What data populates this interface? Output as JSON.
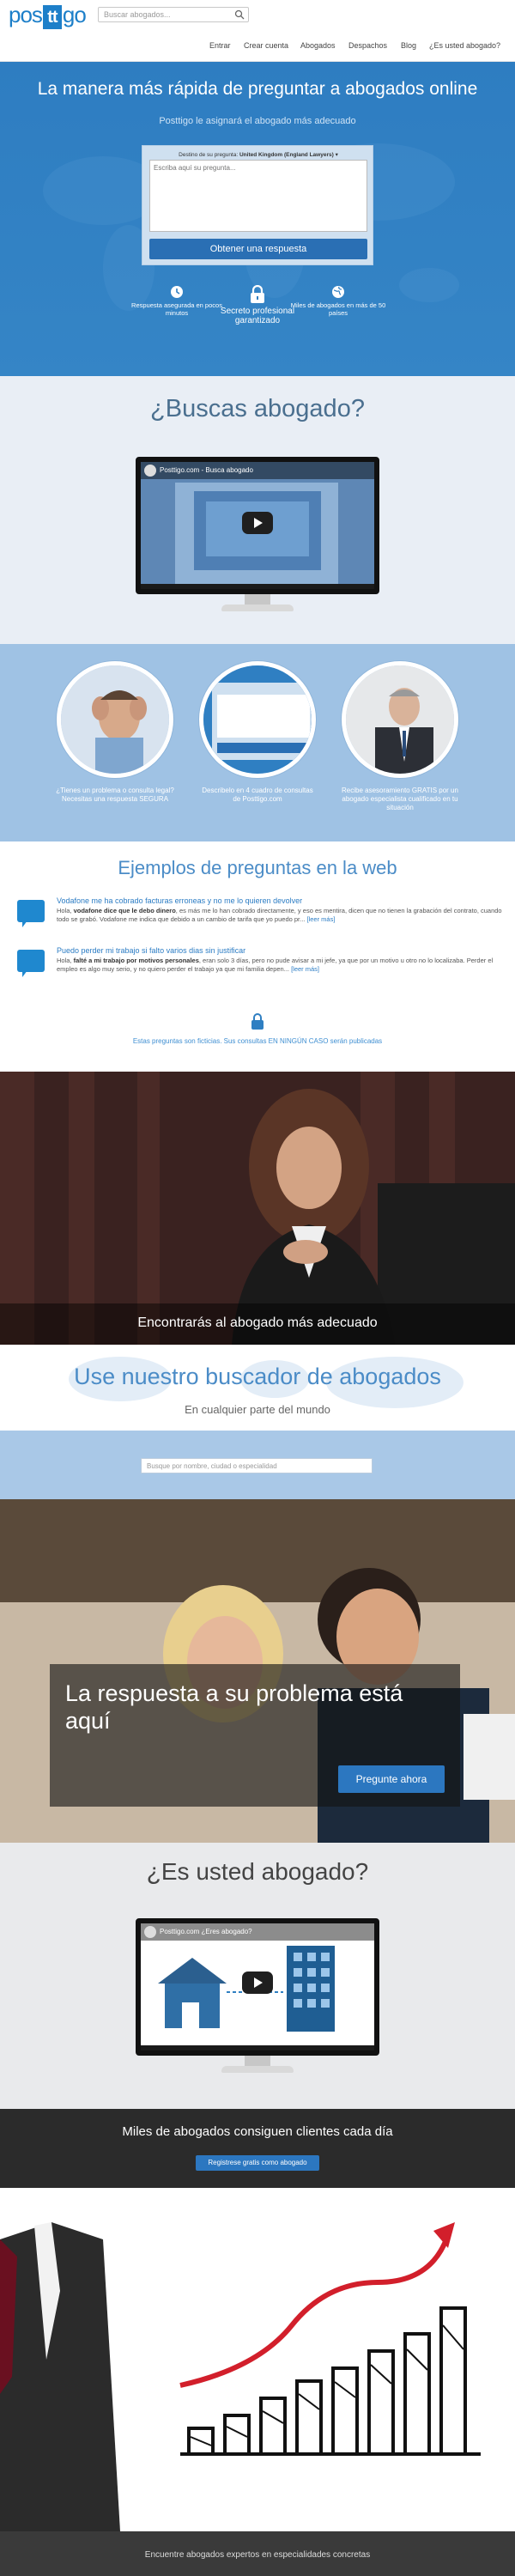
{
  "header": {
    "logo": "postt go",
    "search_placeholder": "Buscar abogados...",
    "nav": [
      "Entrar",
      "Crear cuenta",
      "Abogados",
      "Despachos",
      "Blog",
      "¿Es usted abogado?"
    ]
  },
  "hero": {
    "title": "La manera más rápida de preguntar a abogados online",
    "subtitle": "Posttigo le asignará el abogado más adecuado",
    "destination_label": "Destino de su pregunta:",
    "destination_value": "United Kingdom (England Lawyers)",
    "question_placeholder": "Escriba aquí su pregunta...",
    "submit_label": "Obtener una respuesta",
    "features": [
      {
        "icon": "clock-icon",
        "text": "Respuesta asegurada en pocos minutos"
      },
      {
        "icon": "lock-icon",
        "text": "Secreto profesional garantizado"
      },
      {
        "icon": "globe-icon",
        "text": "Miles de abogados en más de 50 países"
      }
    ]
  },
  "search_section": {
    "title": "¿Buscas abogado?",
    "video_title": "Posttigo.com - Busca abogado"
  },
  "steps": [
    {
      "text": "¿Tienes un problema o consulta legal? Necesitas una respuesta SEGURA"
    },
    {
      "text": "Describelo en 4 cuadro de consultas de Posttigo.com"
    },
    {
      "text": "Recibe asesoramiento GRATIS por un abogado especialista cualificado en tu situación"
    }
  ],
  "examples": {
    "title": "Ejemplos de preguntas en la web",
    "items": [
      {
        "title": "Vodafone me ha cobrado facturas erroneas y no me lo quieren devolver",
        "pre": "Hola, ",
        "bold": "vodafone dice que le debo dinero",
        "post": ", es más me lo han cobrado directamente, y eso es mentira, dicen que no tienen la grabación del contrato, cuando todo se grabó. Vodafone me indica que debido a un cambio de tarifa que yo puedo pr...",
        "more": "[leer más]"
      },
      {
        "title": "Puedo perder mi trabajo si falto varios dias sin justificar",
        "pre": "Hola, ",
        "bold": "falté a mi trabajo por motivos personales",
        "post": ", eran solo 3 días, pero no pude avisar a mi jefe, ya que por un motivo u otro no lo localizaba. Perder el empleo es algo muy serio, y no quiero perder el trabajo ya que mi familia depen...",
        "more": "[leer más]"
      }
    ],
    "privacy_note": "Estas preguntas son ficticias. Sus consultas EN NINGÚN CASO serán publicadas"
  },
  "photo_caption": "Encontrarás al abogado más adecuado",
  "finder": {
    "title": "Use nuestro buscador de abogados",
    "subtitle": "En cualquier parte del mundo",
    "placeholder": "Busque por nombre, ciudad o especialidad"
  },
  "cta": {
    "title": "La respuesta a su problema está aquí",
    "button": "Pregunte ahora"
  },
  "lawyer_section": {
    "title": "¿Es usted abogado?",
    "video_title": "Posttigo.com ¿Eres abogado?"
  },
  "lawyers_banner": {
    "title": "Miles de abogados consiguen clientes cada día",
    "button": "Registrese gratis como abogado"
  },
  "footer": {
    "text": "Encuentre abogados expertos en especialidades concretas"
  }
}
